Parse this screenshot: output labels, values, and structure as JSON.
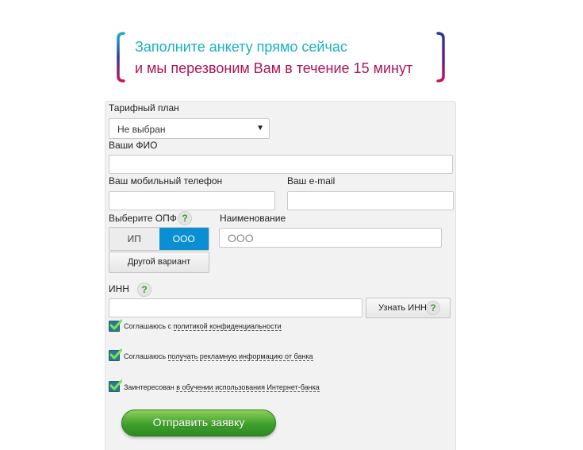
{
  "header": {
    "line1": "Заполните анкету прямо сейчас",
    "line2": "и мы перезвоним Вам в течение 15 минут",
    "colors": {
      "line1": "#1bb0c8",
      "line2": "#b0145a"
    }
  },
  "form": {
    "tariff": {
      "label": "Тарифный план",
      "selected": "Не выбран"
    },
    "name": {
      "label": "Ваши ФИО",
      "value": ""
    },
    "phone": {
      "label": "Ваш мобильный телефон",
      "value": ""
    },
    "email": {
      "label": "Ваш e-mail",
      "value": ""
    },
    "opf": {
      "label": "Выберите ОПФ",
      "help": "?",
      "options": [
        "ИП",
        "ООО"
      ],
      "selected": "ООО",
      "other": "Другой вариант"
    },
    "org_name": {
      "label": "Наименование",
      "placeholder": "ООО"
    },
    "inn": {
      "label": "ИНН",
      "help": "?",
      "value": "",
      "lookup": "Узнать ИНН",
      "lookup_help": "?"
    },
    "consents": [
      {
        "prefix": "Соглашаюсь с ",
        "link": "политикой конфиденциальности",
        "suffix": "",
        "checked": true
      },
      {
        "prefix": "Соглашаюсь ",
        "link": "получать рекламную информацию от банка",
        "suffix": "",
        "checked": true
      },
      {
        "prefix": "Заинтересован ",
        "link": "в обучении использования Интернет-банка",
        "suffix": "",
        "checked": true
      }
    ],
    "submit": "Отправить заявку",
    "accent_color": "#0a8fd2",
    "submit_color": "#3fa02b"
  }
}
